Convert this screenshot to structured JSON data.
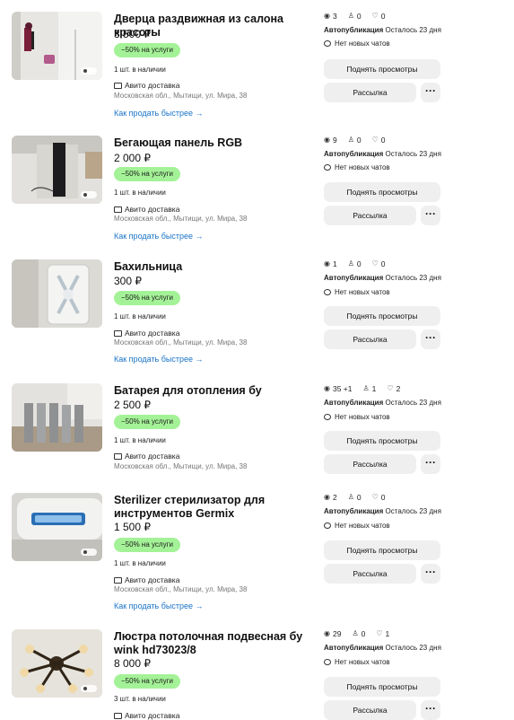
{
  "listings": [
    {
      "title": "Дверца раздвижная из салона красоты",
      "price": "3 500 ₽",
      "promo": "−50% на услуги",
      "stock": "1 шт. в наличии",
      "delivery": "Авито доставка",
      "address": "Московская обл., Мытищи, ул. Мира, 38",
      "howto": "Как продать быстрее →",
      "views": "3",
      "contacts": "0",
      "favorites": "0",
      "autopub_label": "Автопубликация",
      "autopub_rest": "Осталось 23 дня",
      "chats": "Нет новых чатов",
      "boost": "Поднять просмотры",
      "mail": "Рассылка",
      "more": "···"
    },
    {
      "title": "Бегающая панель RGB",
      "price": "2 000 ₽",
      "promo": "−50% на услуги",
      "stock": "1 шт. в наличии",
      "delivery": "Авито доставка",
      "address": "Московская обл., Мытищи, ул. Мира, 38",
      "howto": "Как продать быстрее →",
      "views": "9",
      "contacts": "0",
      "favorites": "0",
      "autopub_label": "Автопубликация",
      "autopub_rest": "Осталось 23 дня",
      "chats": "Нет новых чатов",
      "boost": "Поднять просмотры",
      "mail": "Рассылка",
      "more": "···"
    },
    {
      "title": "Бахильница",
      "price": "300 ₽",
      "promo": "−50% на услуги",
      "stock": "1 шт. в наличии",
      "delivery": "Авито доставка",
      "address": "Московская обл., Мытищи, ул. Мира, 38",
      "howto": "Как продать быстрее →",
      "views": "1",
      "contacts": "0",
      "favorites": "0",
      "autopub_label": "Автопубликация",
      "autopub_rest": "Осталось 23 дня",
      "chats": "Нет новых чатов",
      "boost": "Поднять просмотры",
      "mail": "Рассылка",
      "more": "···"
    },
    {
      "title": "Батарея для отопления бу",
      "price": "2 500 ₽",
      "promo": "−50% на услуги",
      "stock": "1 шт. в наличии",
      "delivery": "Авито доставка",
      "address": "Московская обл., Мытищи, ул. Мира, 38",
      "howto": "Как продать быстрее →",
      "views": "35 +1",
      "contacts": "1",
      "favorites": "2",
      "autopub_label": "Автопубликация",
      "autopub_rest": "Осталось 23 дня",
      "chats": "Нет новых чатов",
      "boost": "Поднять просмотры",
      "mail": "Рассылка",
      "more": "···"
    },
    {
      "title": "Sterilizer стерилизатор для инструментов Germix",
      "price": "1 500 ₽",
      "promo": "−50% на услуги",
      "stock": "1 шт. в наличии",
      "delivery": "Авито доставка",
      "address": "Московская обл., Мытищи, ул. Мира, 38",
      "howto": "Как продать быстрее →",
      "views": "2",
      "contacts": "0",
      "favorites": "0",
      "autopub_label": "Автопубликация",
      "autopub_rest": "Осталось 23 дня",
      "chats": "Нет новых чатов",
      "boost": "Поднять просмотры",
      "mail": "Рассылка",
      "more": "···"
    },
    {
      "title": "Люстра потолочная подвесная бу wink hd73023/8",
      "price": "8 000 ₽",
      "promo": "−50% на услуги",
      "stock": "3 шт. в наличии",
      "delivery": "Авито доставка",
      "address": "",
      "howto": "",
      "views": "29",
      "contacts": "0",
      "favorites": "1",
      "autopub_label": "Автопубликация",
      "autopub_rest": "Осталось 23 дня",
      "chats": "Нет новых чатов",
      "boost": "Поднять просмотры",
      "mail": "Рассылка",
      "more": "···"
    }
  ],
  "icons": {
    "views": "eye-icon",
    "contacts": "person-icon",
    "favorites": "heart-icon",
    "chats": "chat-bubble-icon",
    "delivery": "truck-icon",
    "more": "ellipsis-icon"
  },
  "colors": {
    "promo": "#a4f297",
    "link": "#1a73c7",
    "button": "#efefef"
  }
}
